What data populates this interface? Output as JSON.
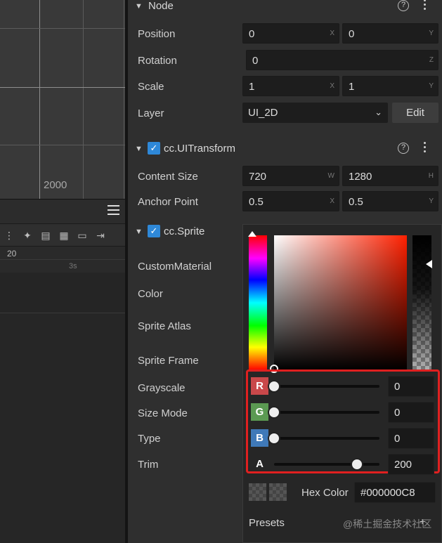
{
  "scene": {
    "axis_label": "2000"
  },
  "timeline": {
    "ruler_major": "20",
    "ruler_minor": "3s",
    "toolbar_icons": [
      "grip-icon",
      "add-keyframe-icon",
      "save-icon",
      "film-icon",
      "clip-icon",
      "exit-icon"
    ]
  },
  "node": {
    "title": "Node",
    "position": {
      "label": "Position",
      "x": "0",
      "x_axis": "X",
      "y": "0",
      "y_axis": "Y"
    },
    "rotation": {
      "label": "Rotation",
      "z": "0",
      "z_axis": "Z"
    },
    "scale": {
      "label": "Scale",
      "x": "1",
      "x_axis": "X",
      "y": "1",
      "y_axis": "Y"
    },
    "layer": {
      "label": "Layer",
      "value": "UI_2D",
      "edit_label": "Edit"
    }
  },
  "ui_transform": {
    "title": "cc.UITransform",
    "content_size": {
      "label": "Content Size",
      "w": "720",
      "w_axis": "W",
      "h": "1280",
      "h_axis": "H"
    },
    "anchor_point": {
      "label": "Anchor Point",
      "x": "0.5",
      "x_axis": "X",
      "y": "0.5",
      "y_axis": "Y"
    }
  },
  "sprite": {
    "title": "cc.Sprite",
    "labels": [
      "CustomMaterial",
      "Color",
      "Sprite Atlas",
      "Sprite Frame",
      "Grayscale",
      "Size Mode",
      "Type",
      "Trim"
    ]
  },
  "color_picker": {
    "channels": [
      {
        "tag": "R",
        "value": "0",
        "level": 0,
        "color": "#c9484a"
      },
      {
        "tag": "G",
        "value": "0",
        "level": 0,
        "color": "#5b9a52"
      },
      {
        "tag": "B",
        "value": "0",
        "level": 0,
        "color": "#3f79b8"
      },
      {
        "tag": "A",
        "value": "200",
        "level": 0.784,
        "color": ""
      }
    ],
    "hex_label": "Hex Color",
    "hex_value": "#000000C8",
    "presets_label": "Presets",
    "highlight_color": "#e02020"
  },
  "watermark": "@稀土掘金技术社区"
}
